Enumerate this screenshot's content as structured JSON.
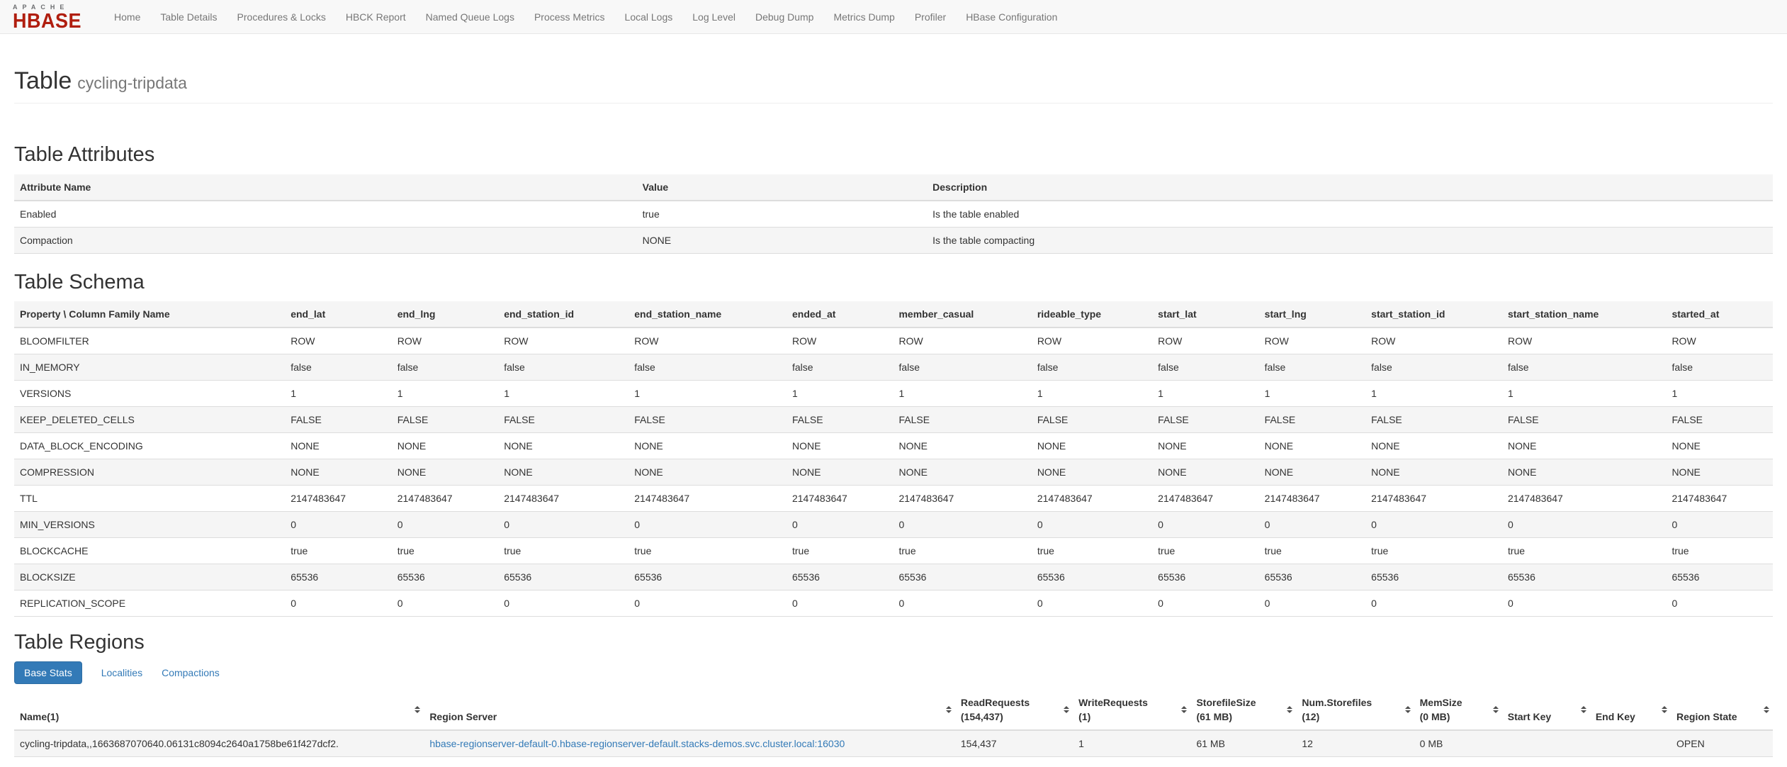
{
  "colors": {
    "brand_red": "#b01e0f",
    "accent_blue": "#337ab7",
    "nav_text": "#777777",
    "navbar_bg": "#f8f8f8",
    "stripe_bg": "#f5f5f5",
    "text": "#333333"
  },
  "navbar": {
    "logo_top": "APACHE",
    "logo_bottom": "HBASE",
    "items": [
      "Home",
      "Table Details",
      "Procedures & Locks",
      "HBCK Report",
      "Named Queue Logs",
      "Process Metrics",
      "Local Logs",
      "Log Level",
      "Debug Dump",
      "Metrics Dump",
      "Profiler",
      "HBase Configuration"
    ]
  },
  "page": {
    "title": "Table",
    "subtitle": "cycling-tripdata"
  },
  "attributes": {
    "heading": "Table Attributes",
    "columns": [
      "Attribute Name",
      "Value",
      "Description"
    ],
    "rows": [
      {
        "name": "Enabled",
        "value": "true",
        "description": "Is the table enabled"
      },
      {
        "name": "Compaction",
        "value": "NONE",
        "description": "Is the table compacting"
      }
    ]
  },
  "schema": {
    "heading": "Table Schema",
    "corner_label": "Property \\ Column Family Name",
    "families": [
      "end_lat",
      "end_lng",
      "end_station_id",
      "end_station_name",
      "ended_at",
      "member_casual",
      "rideable_type",
      "start_lat",
      "start_lng",
      "start_station_id",
      "start_station_name",
      "started_at"
    ],
    "rows": [
      {
        "property": "BLOOMFILTER",
        "value": "ROW"
      },
      {
        "property": "IN_MEMORY",
        "value": "false"
      },
      {
        "property": "VERSIONS",
        "value": "1"
      },
      {
        "property": "KEEP_DELETED_CELLS",
        "value": "FALSE"
      },
      {
        "property": "DATA_BLOCK_ENCODING",
        "value": "NONE"
      },
      {
        "property": "COMPRESSION",
        "value": "NONE"
      },
      {
        "property": "TTL",
        "value": "2147483647"
      },
      {
        "property": "MIN_VERSIONS",
        "value": "0"
      },
      {
        "property": "BLOCKCACHE",
        "value": "true"
      },
      {
        "property": "BLOCKSIZE",
        "value": "65536"
      },
      {
        "property": "REPLICATION_SCOPE",
        "value": "0"
      }
    ]
  },
  "regions": {
    "heading": "Table Regions",
    "tabs": [
      {
        "label": "Base Stats",
        "active": true
      },
      {
        "label": "Localities",
        "active": false
      },
      {
        "label": "Compactions",
        "active": false
      }
    ],
    "columns": [
      {
        "line1": "Name(1)",
        "line2": ""
      },
      {
        "line1": "Region Server",
        "line2": ""
      },
      {
        "line1": "ReadRequests",
        "line2": "(154,437)"
      },
      {
        "line1": "WriteRequests",
        "line2": "(1)"
      },
      {
        "line1": "StorefileSize",
        "line2": "(61 MB)"
      },
      {
        "line1": "Num.Storefiles",
        "line2": "(12)"
      },
      {
        "line1": "MemSize",
        "line2": "(0 MB)"
      },
      {
        "line1": "Start Key",
        "line2": ""
      },
      {
        "line1": "End Key",
        "line2": ""
      },
      {
        "line1": "Region State",
        "line2": ""
      }
    ],
    "rows": [
      {
        "name": "cycling-tripdata,,1663687070640.06131c8094c2640a1758be61f427dcf2.",
        "region_server": "hbase-regionserver-default-0.hbase-regionserver-default.stacks-demos.svc.cluster.local:16030",
        "read_requests": "154,437",
        "write_requests": "1",
        "storefile_size": "61 MB",
        "num_storefiles": "12",
        "mem_size": "0 MB",
        "start_key": "",
        "end_key": "",
        "region_state": "OPEN"
      }
    ]
  }
}
